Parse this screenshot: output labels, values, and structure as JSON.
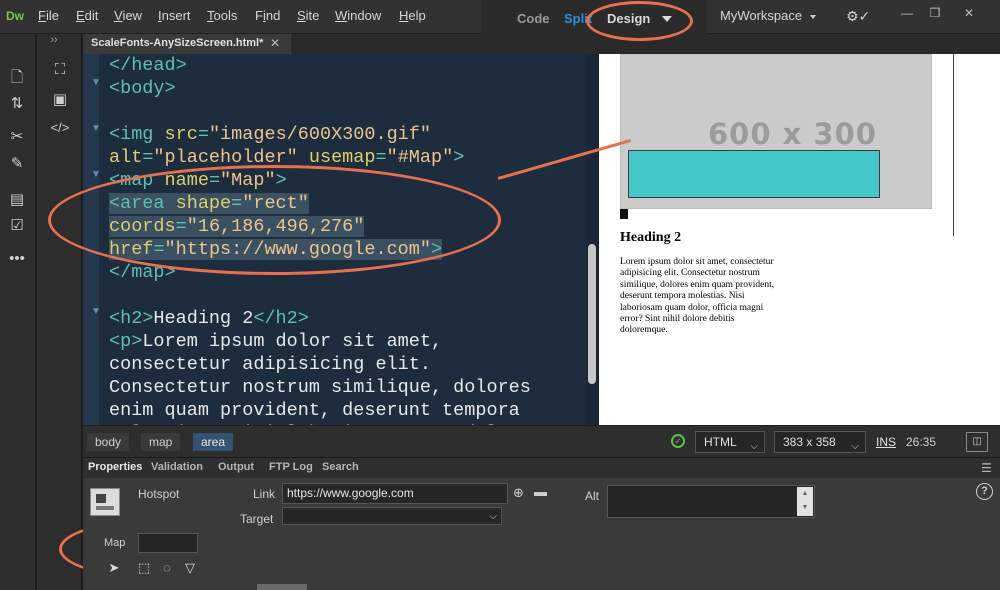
{
  "app": {
    "logo": "Dw"
  },
  "menu": {
    "items": [
      {
        "pre": "",
        "ul": "F",
        "post": "ile"
      },
      {
        "pre": "",
        "ul": "E",
        "post": "dit"
      },
      {
        "pre": "",
        "ul": "V",
        "post": "iew"
      },
      {
        "pre": "",
        "ul": "I",
        "post": "nsert"
      },
      {
        "pre": "",
        "ul": "T",
        "post": "ools"
      },
      {
        "pre": "F",
        "ul": "i",
        "post": "nd"
      },
      {
        "pre": "",
        "ul": "S",
        "post": "ite"
      },
      {
        "pre": "",
        "ul": "W",
        "post": "indow"
      },
      {
        "pre": "",
        "ul": "H",
        "post": "elp"
      }
    ]
  },
  "view_switch": {
    "code": "Code",
    "split": "Split",
    "design": "Design"
  },
  "workspace": {
    "label": "MyWorkspace"
  },
  "document": {
    "tab_label": "ScaleFonts-AnySizeScreen.html*",
    "close": "✕"
  },
  "code_lines": [
    "</head>",
    "<body>",
    "",
    "<img src=\"images/600X300.gif\"",
    "alt=\"placeholder\" usemap=\"#Map\">",
    "<map name=\"Map\">",
    "<area shape=\"rect\"",
    "coords=\"16,186,496,276\"",
    "href=\"https://www.google.com\">",
    "</map>",
    "",
    "<h2>Heading 2</h2>",
    "<p>Lorem ipsum dolor sit amet,",
    "consectetur adipisicing elit.",
    "Consectetur nostrum similique, dolores",
    "enim quam provident, deserunt tempora",
    "molestias. Nisi laboriosam quam dolor"
  ],
  "design_view": {
    "placeholder_text": "600 x 300",
    "heading": "Heading 2",
    "paragraph": "Lorem ipsum dolor sit amet, consectetur adipisicing elit. Consectetur nostrum similique, dolores enim quam provident, deserunt tempora molestias. Nisi laboriosam quam dolor, officia magni error? Sint nihil dolore debitis doloremque."
  },
  "status_bar": {
    "breadcrumbs": [
      "body",
      "map",
      "area"
    ],
    "doc_type": "HTML",
    "window_size": "383 x 358",
    "insert_mode": "INS",
    "cursor_position": "26:35"
  },
  "properties": {
    "tabs": [
      "Properties",
      "Validation",
      "Output",
      "FTP Log",
      "Search"
    ],
    "hotspot_label": "Hotspot",
    "link_label": "Link",
    "link_value": "https://www.google.com",
    "target_label": "Target",
    "target_value": "",
    "alt_label": "Alt",
    "alt_value": "",
    "map_label": "Map",
    "map_value": "",
    "help": "?"
  },
  "colors": {
    "accent_split": "#2e8fd8",
    "annotation": "#e8704f",
    "hotspot_fill": "#44c8cc",
    "active_crumb": "#365271"
  },
  "icons": [
    "file-icon",
    "transfer-icon",
    "snippets-icon",
    "css-designer-icon",
    "comment-icon",
    "validate-icon",
    "more-icon",
    "dom-tree-icon",
    "assets-icon",
    "code-icon",
    "gear-check-icon",
    "point-to-file-icon",
    "folder-icon",
    "pointer-tool-icon",
    "rect-hotspot-icon",
    "circle-hotspot-icon",
    "polygon-hotspot-icon",
    "preview-icon"
  ]
}
